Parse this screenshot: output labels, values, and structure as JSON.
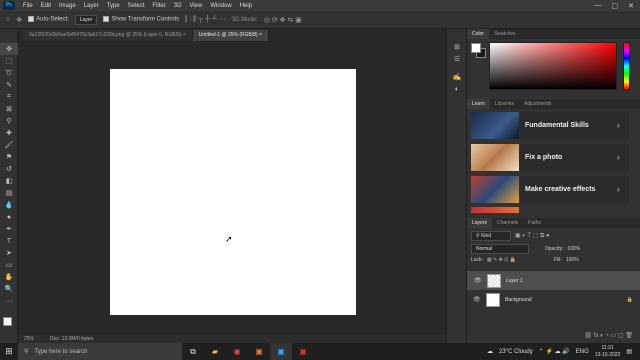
{
  "app": {
    "logo": "Ps"
  },
  "menubar": {
    "items": [
      "File",
      "Edit",
      "Image",
      "Layer",
      "Type",
      "Select",
      "Filter",
      "3D",
      "View",
      "Window",
      "Help"
    ]
  },
  "options_bar": {
    "auto_select_label": "Auto-Select:",
    "auto_select_value": "Layer",
    "show_transform_label": "Show Transform Controls",
    "mode_label": "3D Mode:"
  },
  "tabs": [
    {
      "label": "9a22f930d3b6ae5bf5479c3a917c228d.png @ 25% (Layer 0, RGB/8)",
      "active": false
    },
    {
      "label": "Untitled-1 @ 25% (RGB/8)",
      "active": true
    }
  ],
  "status": {
    "zoom": "25%",
    "doc": "Doc: 12.0M/0 bytes"
  },
  "color_panel": {
    "tabs": [
      "Color",
      "Swatches"
    ]
  },
  "learn_panel": {
    "tabs": [
      "Learn",
      "Libraries",
      "Adjustments"
    ],
    "cards": [
      "Fundamental Skills",
      "Fix a photo",
      "Make creative effects"
    ]
  },
  "layers_panel": {
    "tabs": [
      "Layers",
      "Channels",
      "Paths"
    ],
    "kind_label": "Kind",
    "blend_mode": "Normal",
    "opacity_label": "Opacity:",
    "opacity_value": "100%",
    "lock_label": "Lock:",
    "fill_label": "Fill:",
    "fill_value": "100%",
    "layers": [
      {
        "name": "Layer 1",
        "selected": true
      },
      {
        "name": "Background",
        "selected": false
      }
    ]
  },
  "taskbar": {
    "search_placeholder": "Type here to search",
    "weather": "23°C  Cloudy",
    "lang": "ENG",
    "time": "11:31",
    "date": "13-10-2022"
  },
  "colors": {
    "canvas_bg": "#282828",
    "panel_bg": "#323232",
    "accent": "#31a8ff"
  }
}
